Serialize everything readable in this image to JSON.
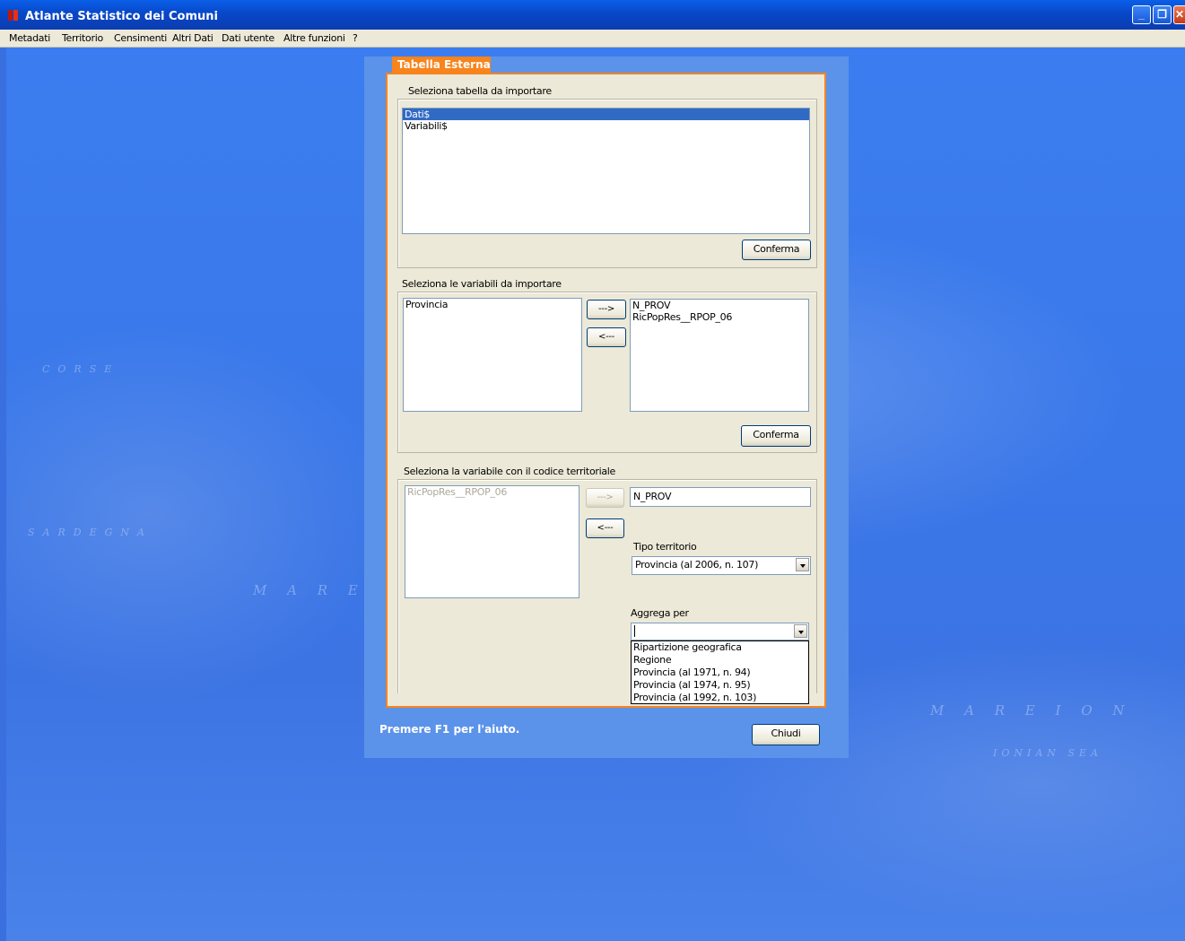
{
  "window": {
    "title": "Atlante Statistico dei Comuni"
  },
  "menu": [
    "Metadati",
    "Territorio",
    "Censimenti",
    "Altri Dati",
    "Dati utente",
    "Altre funzioni",
    "?"
  ],
  "desktop": {
    "bg_labels": [
      "CORSE",
      "SARDEGNA",
      "M A R E",
      "M A R E   I O N",
      "IONIAN SEA"
    ]
  },
  "dialog": {
    "tab_label": "Tabella Esterna",
    "section1": {
      "label": "Seleziona tabella da importare",
      "items": [
        "Dati$",
        "Variabili$"
      ],
      "selected": "Dati$",
      "confirm_label": "Conferma"
    },
    "section2": {
      "label": "Seleziona le variabili da importare",
      "left_items": [
        "Provincia"
      ],
      "right_items": [
        "N_PROV",
        "RicPopRes__RPOP_06"
      ],
      "add_label": "--->",
      "remove_label": "<---",
      "confirm_label": "Conferma"
    },
    "section3": {
      "label": "Seleziona la variabile con il codice territoriale",
      "left_items": [
        "RicPopRes__RPOP_06"
      ],
      "add_label": "--->",
      "remove_label": "<---",
      "code_value": "N_PROV",
      "tipo_label": "Tipo territorio",
      "tipo_value": "Provincia (al 2006, n. 107)",
      "aggrega_label": "Aggrega per",
      "aggrega_value": "",
      "aggrega_options": [
        "Ripartizione geografica",
        "Regione",
        "Provincia (al 1971, n. 94)",
        "Provincia (al 1974, n. 95)",
        "Provincia (al 1992, n. 103)"
      ]
    },
    "help_text": "Premere F1 per l'aiuto.",
    "close_label": "Chiudi"
  },
  "colors": {
    "accent": "#f7841c",
    "titlebar": "#0a5fe8",
    "selection": "#316ac5",
    "desktop": "#3b7df0"
  }
}
